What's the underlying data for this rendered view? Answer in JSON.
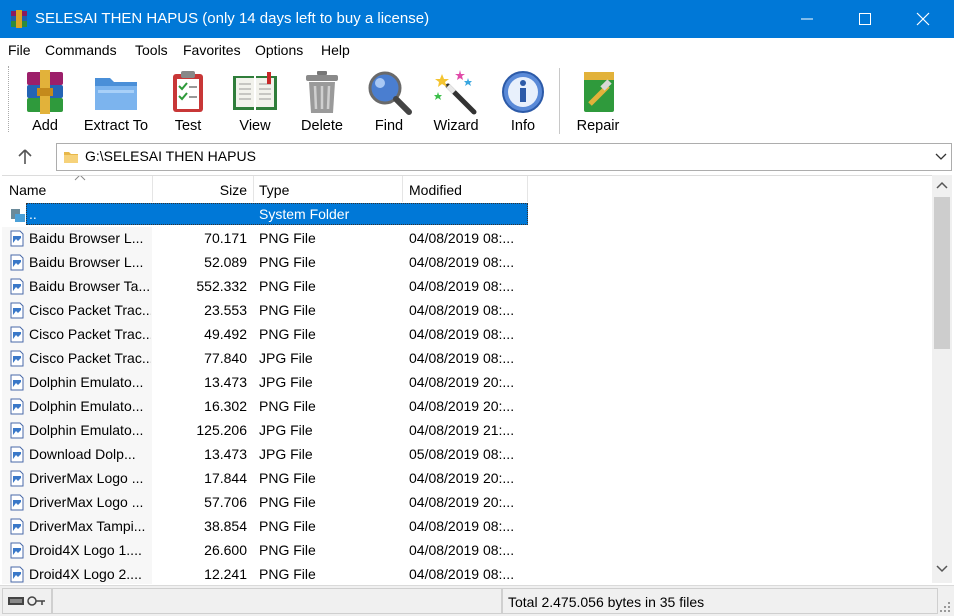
{
  "window": {
    "title": "SELESAI THEN HAPUS (only 14 days left to buy a license)"
  },
  "menu": [
    "File",
    "Commands",
    "Tools",
    "Favorites",
    "Options",
    "Help"
  ],
  "toolbar": {
    "add": "Add",
    "extract": "Extract To",
    "test": "Test",
    "view": "View",
    "delete": "Delete",
    "find": "Find",
    "wizard": "Wizard",
    "info": "Info",
    "repair": "Repair"
  },
  "address": {
    "path": "G:\\SELESAI THEN HAPUS"
  },
  "columns": {
    "name": "Name",
    "size": "Size",
    "type": "Type",
    "modified": "Modified"
  },
  "rows": [
    {
      "name": "..",
      "size": "",
      "type": "System Folder",
      "modified": ""
    },
    {
      "name": "Baidu Browser L...",
      "size": "70.171",
      "type": "PNG File",
      "modified": "04/08/2019 08:..."
    },
    {
      "name": "Baidu Browser L...",
      "size": "52.089",
      "type": "PNG File",
      "modified": "04/08/2019 08:..."
    },
    {
      "name": "Baidu Browser Ta...",
      "size": "552.332",
      "type": "PNG File",
      "modified": "04/08/2019 08:..."
    },
    {
      "name": "Cisco Packet Trac...",
      "size": "23.553",
      "type": "PNG File",
      "modified": "04/08/2019 08:..."
    },
    {
      "name": "Cisco Packet Trac...",
      "size": "49.492",
      "type": "PNG File",
      "modified": "04/08/2019 08:..."
    },
    {
      "name": "Cisco Packet Trac...",
      "size": "77.840",
      "type": "JPG File",
      "modified": "04/08/2019 08:..."
    },
    {
      "name": "Dolphin Emulato...",
      "size": "13.473",
      "type": "JPG File",
      "modified": "04/08/2019 20:..."
    },
    {
      "name": "Dolphin Emulato...",
      "size": "16.302",
      "type": "PNG File",
      "modified": "04/08/2019 20:..."
    },
    {
      "name": "Dolphin Emulato...",
      "size": "125.206",
      "type": "JPG File",
      "modified": "04/08/2019 21:..."
    },
    {
      "name": "Download Dolp...",
      "size": "13.473",
      "type": "JPG File",
      "modified": "05/08/2019 08:..."
    },
    {
      "name": "DriverMax Logo ...",
      "size": "17.844",
      "type": "PNG File",
      "modified": "04/08/2019 20:..."
    },
    {
      "name": "DriverMax Logo ...",
      "size": "57.706",
      "type": "PNG File",
      "modified": "04/08/2019 20:..."
    },
    {
      "name": "DriverMax Tampi...",
      "size": "38.854",
      "type": "PNG File",
      "modified": "04/08/2019 08:..."
    },
    {
      "name": "Droid4X Logo 1....",
      "size": "26.600",
      "type": "PNG File",
      "modified": "04/08/2019 08:..."
    },
    {
      "name": "Droid4X Logo 2....",
      "size": "12.241",
      "type": "PNG File",
      "modified": "04/08/2019 08:..."
    }
  ],
  "status": {
    "summary": "Total 2.475.056 bytes in 35 files"
  },
  "colors": {
    "titlebar": "#0078d7",
    "selection": "#0078d7"
  }
}
